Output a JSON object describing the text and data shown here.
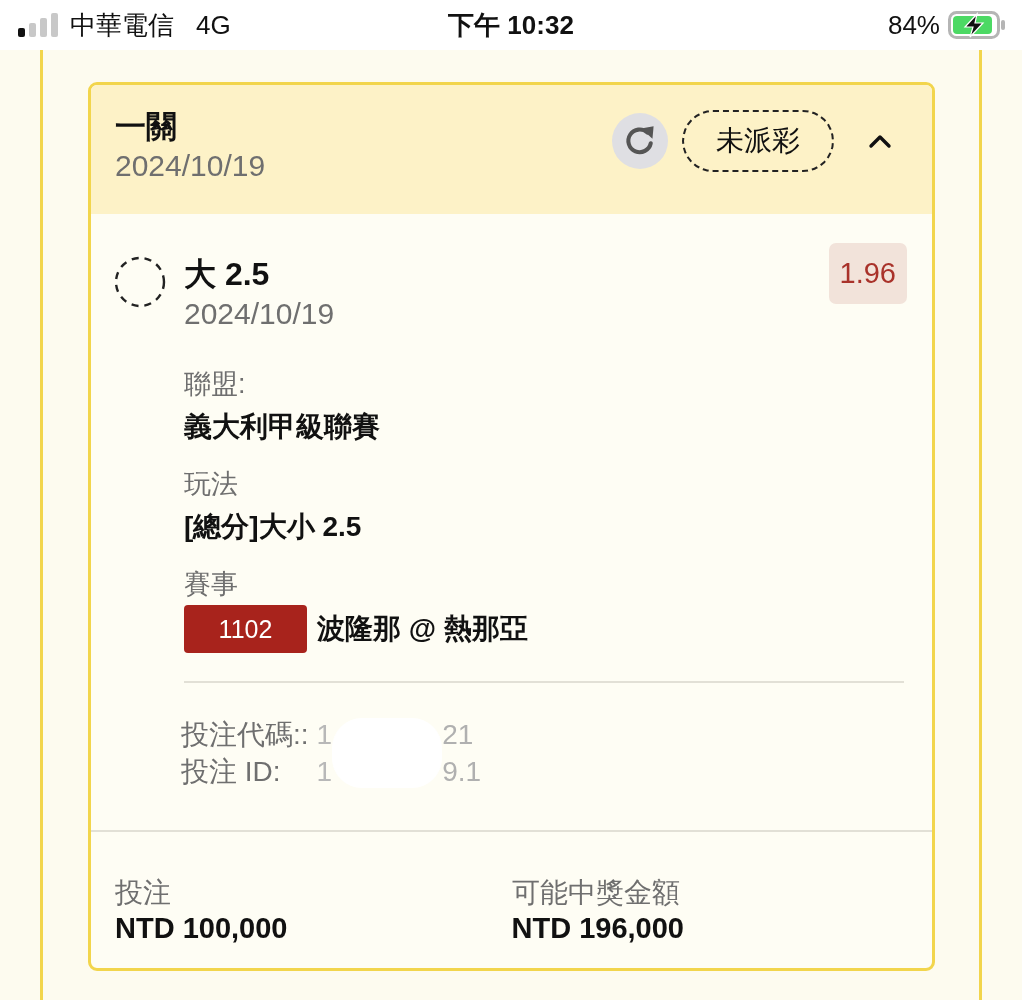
{
  "status_bar": {
    "carrier": "中華電信",
    "network": "4G",
    "time": "下午 10:32",
    "battery": "84%",
    "charging": true
  },
  "ticket": {
    "title": "一關",
    "date": "2024/10/19",
    "status": "未派彩",
    "expanded": true,
    "selection": {
      "name": "大 2.5",
      "date": "2024/10/19",
      "odds": "1.96",
      "settled": false
    },
    "details": [
      {
        "kind": "text",
        "label": "聯盟:",
        "value": "義大利甲級聯賽"
      },
      {
        "kind": "text",
        "label": "玩法",
        "value": "[總分]大小 2.5"
      },
      {
        "kind": "match",
        "label": "賽事",
        "match_id": "1102",
        "value": "波隆那 @ 熱那亞"
      }
    ],
    "references": [
      {
        "label": "投注代碼::",
        "visible_start": "1",
        "visible_end": "21"
      },
      {
        "label": "投注 ID:",
        "visible_start": "1",
        "visible_end": "9.1"
      }
    ],
    "totals": [
      {
        "label": "投注",
        "amount": "NTD 100,000"
      },
      {
        "label": "可能中獎金額",
        "amount": "NTD 196,000"
      }
    ]
  }
}
